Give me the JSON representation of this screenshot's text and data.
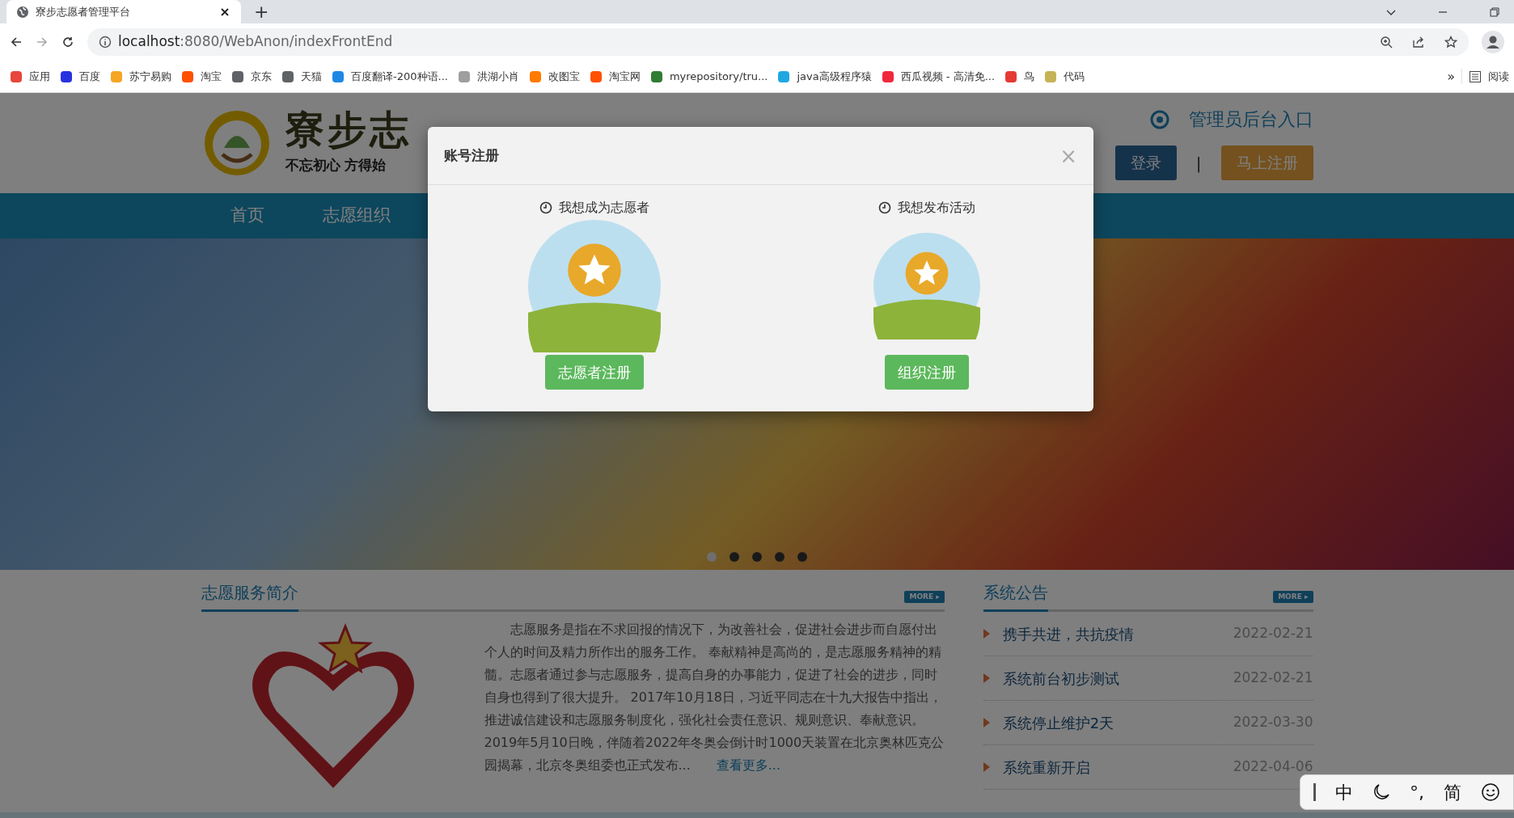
{
  "browser": {
    "tab_title": "寮步志愿者管理平台",
    "new_tab": "+",
    "address": {
      "host": "localhost",
      "path": ":8080/WebAnon/indexFrontEnd"
    },
    "bookmarks": [
      {
        "label": "应用",
        "color": "#e8453c"
      },
      {
        "label": "百度",
        "color": "#2932e1"
      },
      {
        "label": "苏宁易购",
        "color": "#f5a623"
      },
      {
        "label": "淘宝",
        "color": "#ff5000"
      },
      {
        "label": "京东",
        "color": "#5f6368"
      },
      {
        "label": "天猫",
        "color": "#5f6368"
      },
      {
        "label": "百度翻译-200种语...",
        "color": "#1e88e5"
      },
      {
        "label": "洪湖小肖",
        "color": "#9e9e9e"
      },
      {
        "label": "改图宝",
        "color": "#ff7a00"
      },
      {
        "label": "淘宝网",
        "color": "#ff5000"
      },
      {
        "label": "myrepository/tru...",
        "color": "#2e7d32"
      },
      {
        "label": "java高级程序猿",
        "color": "#1fa8e0"
      },
      {
        "label": "西瓜视频 - 高清免...",
        "color": "#f0283c"
      },
      {
        "label": "鸟",
        "color": "#e53935"
      },
      {
        "label": "代码",
        "color": "#c5b358"
      }
    ],
    "more": "»",
    "reading_list": "阅读"
  },
  "header": {
    "logo_title": "寮步志",
    "slogan": "不忘初心 方得始",
    "admin_link": "管理员后台入口",
    "login": "登录",
    "separator": "|",
    "register": "马上注册"
  },
  "nav": [
    "首页",
    "志愿组织"
  ],
  "carousel": {
    "dots": [
      {
        "selected": true
      },
      {
        "selected": false
      },
      {
        "selected": false
      },
      {
        "selected": false
      },
      {
        "selected": false
      }
    ]
  },
  "intro": {
    "title": "志愿服务简介",
    "more": "MORE ▸",
    "text": "志愿服务是指在不求回报的情况下，为改善社会，促进社会进步而自愿付出个人的时间及精力所作出的服务工作。 奉献精神是高尚的，是志愿服务精神的精髓。志愿者通过参与志愿服务，提高自身的办事能力，促进了社会的进步，同时自身也得到了很大提升。 2017年10月18日，习近平同志在十九大报告中指出，推进诚信建设和志愿服务制度化，强化社会责任意识、规则意识、奉献意识。2019年5月10日晚，伴随着2022年冬奥会倒计时1000天装置在北京奥林匹克公园揭幕，北京冬奥组委也正式发布...",
    "link": "查看更多..."
  },
  "notices": {
    "title": "系统公告",
    "more": "MORE ▸",
    "items": [
      {
        "title": "携手共进，共抗疫情",
        "date": "2022-02-21"
      },
      {
        "title": "系统前台初步测试",
        "date": "2022-02-21"
      },
      {
        "title": "系统停止维护2天",
        "date": "2022-03-30"
      },
      {
        "title": "系统重新开启",
        "date": "2022-04-06"
      }
    ]
  },
  "modal": {
    "title": "账号注册",
    "close": "×",
    "options": [
      {
        "caption": "我想成为志愿者",
        "button": "志愿者注册"
      },
      {
        "caption": "我想发布活动",
        "button": "组织注册"
      }
    ]
  },
  "ime_bar": [
    "中",
    "°,",
    "简"
  ]
}
